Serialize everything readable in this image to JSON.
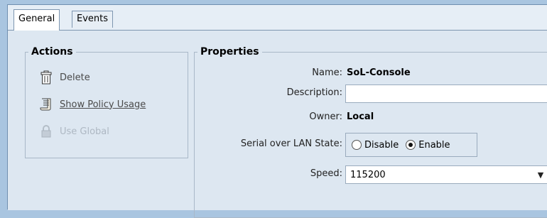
{
  "tabs": [
    {
      "label": "General",
      "active": true
    },
    {
      "label": "Events",
      "active": false
    }
  ],
  "actions": {
    "legend": "Actions",
    "items": [
      {
        "label": "Delete",
        "icon": "trash-icon",
        "enabled": true
      },
      {
        "label": "Show Policy Usage",
        "icon": "scroll-icon",
        "enabled": true
      },
      {
        "label": "Use Global",
        "icon": "lock-icon",
        "enabled": false
      }
    ]
  },
  "properties": {
    "legend": "Properties",
    "name_label": "Name:",
    "name_value": "SoL-Console",
    "description_label": "Description:",
    "description_value": "",
    "owner_label": "Owner:",
    "owner_value": "Local",
    "sol_state_label": "Serial over LAN State:",
    "sol_state_options": [
      "Disable",
      "Enable"
    ],
    "sol_state_selected": "Enable",
    "speed_label": "Speed:",
    "speed_value": "115200"
  },
  "colors": {
    "background": "#a9c5e0",
    "panel": "#dde7f1",
    "link": "#4a4a4a",
    "disabled": "#aeb8c3"
  }
}
